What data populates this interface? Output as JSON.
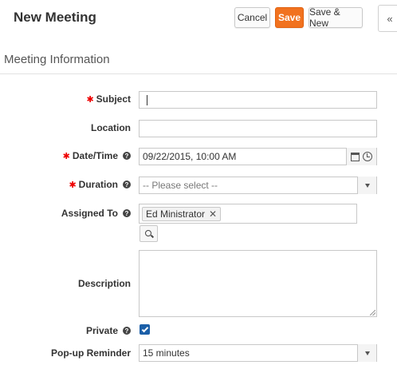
{
  "page": {
    "title": "New Meeting"
  },
  "toolbar": {
    "cancel_label": "Cancel",
    "save_label": "Save",
    "save_new_label": "Save & New",
    "sidebar_toggle": "«"
  },
  "section": {
    "title": "Meeting Information"
  },
  "fields": {
    "subject": {
      "label": "Subject",
      "required": true,
      "value": ""
    },
    "location": {
      "label": "Location",
      "value": ""
    },
    "datetime": {
      "label": "Date/Time",
      "required": true,
      "value": "09/22/2015, 10:00 AM"
    },
    "duration": {
      "label": "Duration",
      "required": true,
      "placeholder": "-- Please select --"
    },
    "assigned_to": {
      "label": "Assigned To",
      "value": "Ed Ministrator",
      "remove_glyph": "✕"
    },
    "description": {
      "label": "Description",
      "value": ""
    },
    "private": {
      "label": "Private",
      "checked": true
    },
    "popup_reminder": {
      "label": "Pop-up Reminder",
      "value": "15 minutes"
    }
  },
  "symbols": {
    "required": "✱",
    "help": "?"
  },
  "colors": {
    "save_button": "#f1721f",
    "required_marker": "#ee0000",
    "checkbox": "#1b5fa8"
  },
  "icons": {
    "datetime": [
      "calendar-icon",
      "clock-icon"
    ],
    "assigned_to": "search-icon",
    "select": "chevron-down-icon",
    "help": "question-circle-icon"
  }
}
